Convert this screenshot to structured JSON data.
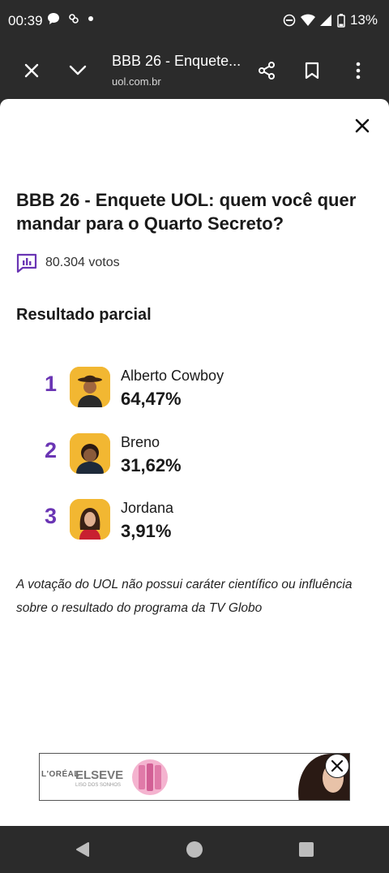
{
  "status_bar": {
    "time": "00:39",
    "battery": "13%",
    "left_icons": [
      "chat-bubble-icon",
      "app-notification-icon",
      "dot-icon"
    ],
    "right_icons": [
      "do-not-disturb-icon",
      "wifi-icon",
      "signal-icon",
      "battery-icon"
    ]
  },
  "browser": {
    "title": "BBB 26 - Enquete...",
    "url": "uol.com.br"
  },
  "poll": {
    "title": "BBB 26 - Enquete UOL: quem você quer mandar para o Quarto Secreto?",
    "votes": "80.304 votos",
    "subtitle": "Resultado parcial",
    "results": [
      {
        "rank": "1",
        "name": "Alberto Cowboy",
        "percent": "64,47%"
      },
      {
        "rank": "2",
        "name": "Breno",
        "percent": "31,62%"
      },
      {
        "rank": "3",
        "name": "Jordana",
        "percent": "3,91%"
      }
    ],
    "disclaimer": "A votação do UOL não possui caráter científico ou influência sobre o resultado do programa da TV Globo"
  },
  "ad": {
    "brand_left": "L'ORÉAL",
    "brand": "ELSEVE",
    "tagline": "LISO DOS SONHOS"
  },
  "colors": {
    "accent": "#6a35b4",
    "chrome": "#2b2b2b",
    "avatar_bg": "#f2b732"
  }
}
